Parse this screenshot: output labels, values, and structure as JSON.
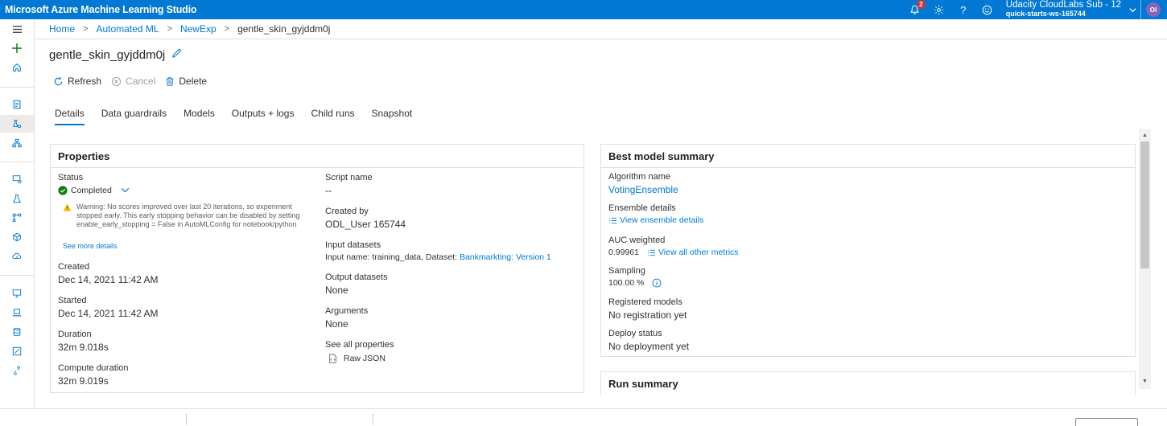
{
  "topbar": {
    "app_title": "Microsoft Azure Machine Learning Studio",
    "notifications_count": "2",
    "subscription": "Udacity CloudLabs Sub - 12",
    "workspace": "quick-starts-ws-165744",
    "avatar_initials": "OI"
  },
  "breadcrumb": {
    "items": [
      "Home",
      "Automated ML",
      "NewExp"
    ],
    "current": "gentle_skin_gyjddm0j"
  },
  "page": {
    "title": "gentle_skin_gyjddm0j"
  },
  "toolbar": {
    "refresh": "Refresh",
    "cancel": "Cancel",
    "delete": "Delete"
  },
  "tabs": [
    "Details",
    "Data guardrails",
    "Models",
    "Outputs + logs",
    "Child runs",
    "Snapshot"
  ],
  "properties": {
    "title": "Properties",
    "status_label": "Status",
    "status_value": "Completed",
    "warning": "Warning: No scores improved over last 20 iterations, so experiment stopped early. This early stopping behavior can be disabled by setting enable_early_stopping = False in AutoMLConfig for notebook/python",
    "see_more": "See more details",
    "created_label": "Created",
    "created_value": "Dec 14, 2021 11:42 AM",
    "started_label": "Started",
    "started_value": "Dec 14, 2021 11:42 AM",
    "duration_label": "Duration",
    "duration_value": "32m 9.018s",
    "compute_duration_label": "Compute duration",
    "compute_duration_value": "32m 9.019s",
    "script_name_label": "Script name",
    "script_name_value": "--",
    "created_by_label": "Created by",
    "created_by_value": "ODL_User 165744",
    "input_datasets_label": "Input datasets",
    "input_datasets_prefix": "Input name: training_data, Dataset:",
    "input_datasets_link": "Bankmarkting: Version 1",
    "output_datasets_label": "Output datasets",
    "output_datasets_value": "None",
    "arguments_label": "Arguments",
    "arguments_value": "None",
    "see_all_label": "See all properties",
    "raw_json": "Raw JSON"
  },
  "best_model": {
    "title": "Best model summary",
    "algorithm_label": "Algorithm name",
    "algorithm_value": "VotingEnsemble",
    "ensemble_label": "Ensemble details",
    "ensemble_link": "View ensemble details",
    "auc_label": "AUC weighted",
    "auc_value": "0.99961",
    "auc_link": "View all other metrics",
    "sampling_label": "Sampling",
    "sampling_value": "100.00 %",
    "registered_label": "Registered models",
    "registered_value": "No registration yet",
    "deploy_label": "Deploy status",
    "deploy_value": "No deployment yet"
  },
  "run_summary": {
    "title": "Run summary"
  },
  "colors": {
    "accent": "#0078d4",
    "success": "#107c10",
    "warning": "#ffb900"
  }
}
